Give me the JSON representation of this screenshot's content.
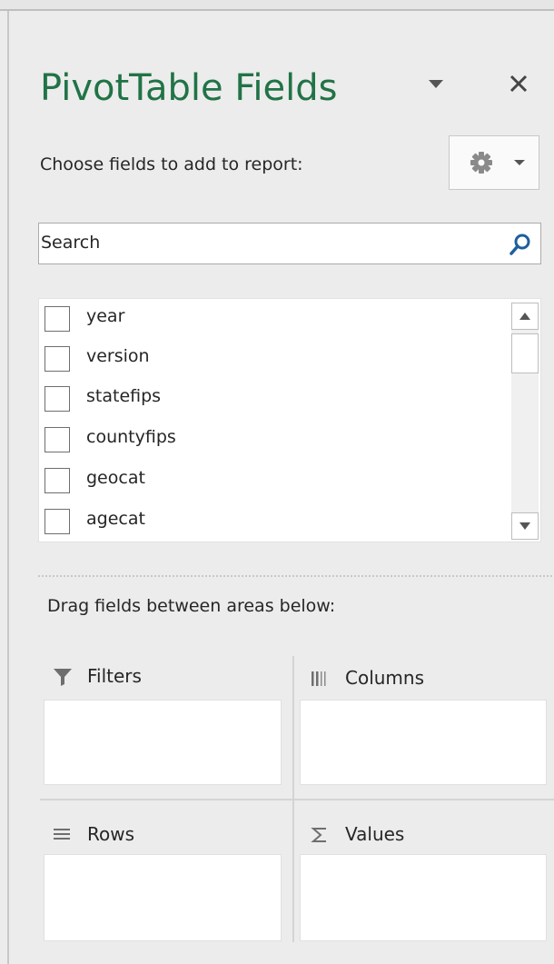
{
  "pane": {
    "title": "PivotTable Fields",
    "choose_label": "Choose fields to add to report:",
    "search_placeholder": "Search",
    "drag_label": "Drag fields between areas below:"
  },
  "fields": [
    {
      "label": "year",
      "checked": false
    },
    {
      "label": "version",
      "checked": false
    },
    {
      "label": "statefips",
      "checked": false
    },
    {
      "label": "countyfips",
      "checked": false
    },
    {
      "label": "geocat",
      "checked": false
    },
    {
      "label": "agecat",
      "checked": false
    }
  ],
  "areas": {
    "filters": {
      "label": "Filters",
      "icon": "filter-icon"
    },
    "columns": {
      "label": "Columns",
      "icon": "columns-icon"
    },
    "rows": {
      "label": "Rows",
      "icon": "rows-icon"
    },
    "values": {
      "label": "Values",
      "icon": "sigma-icon"
    }
  },
  "colors": {
    "title": "#217346",
    "search_icon": "#1e5e9e"
  }
}
